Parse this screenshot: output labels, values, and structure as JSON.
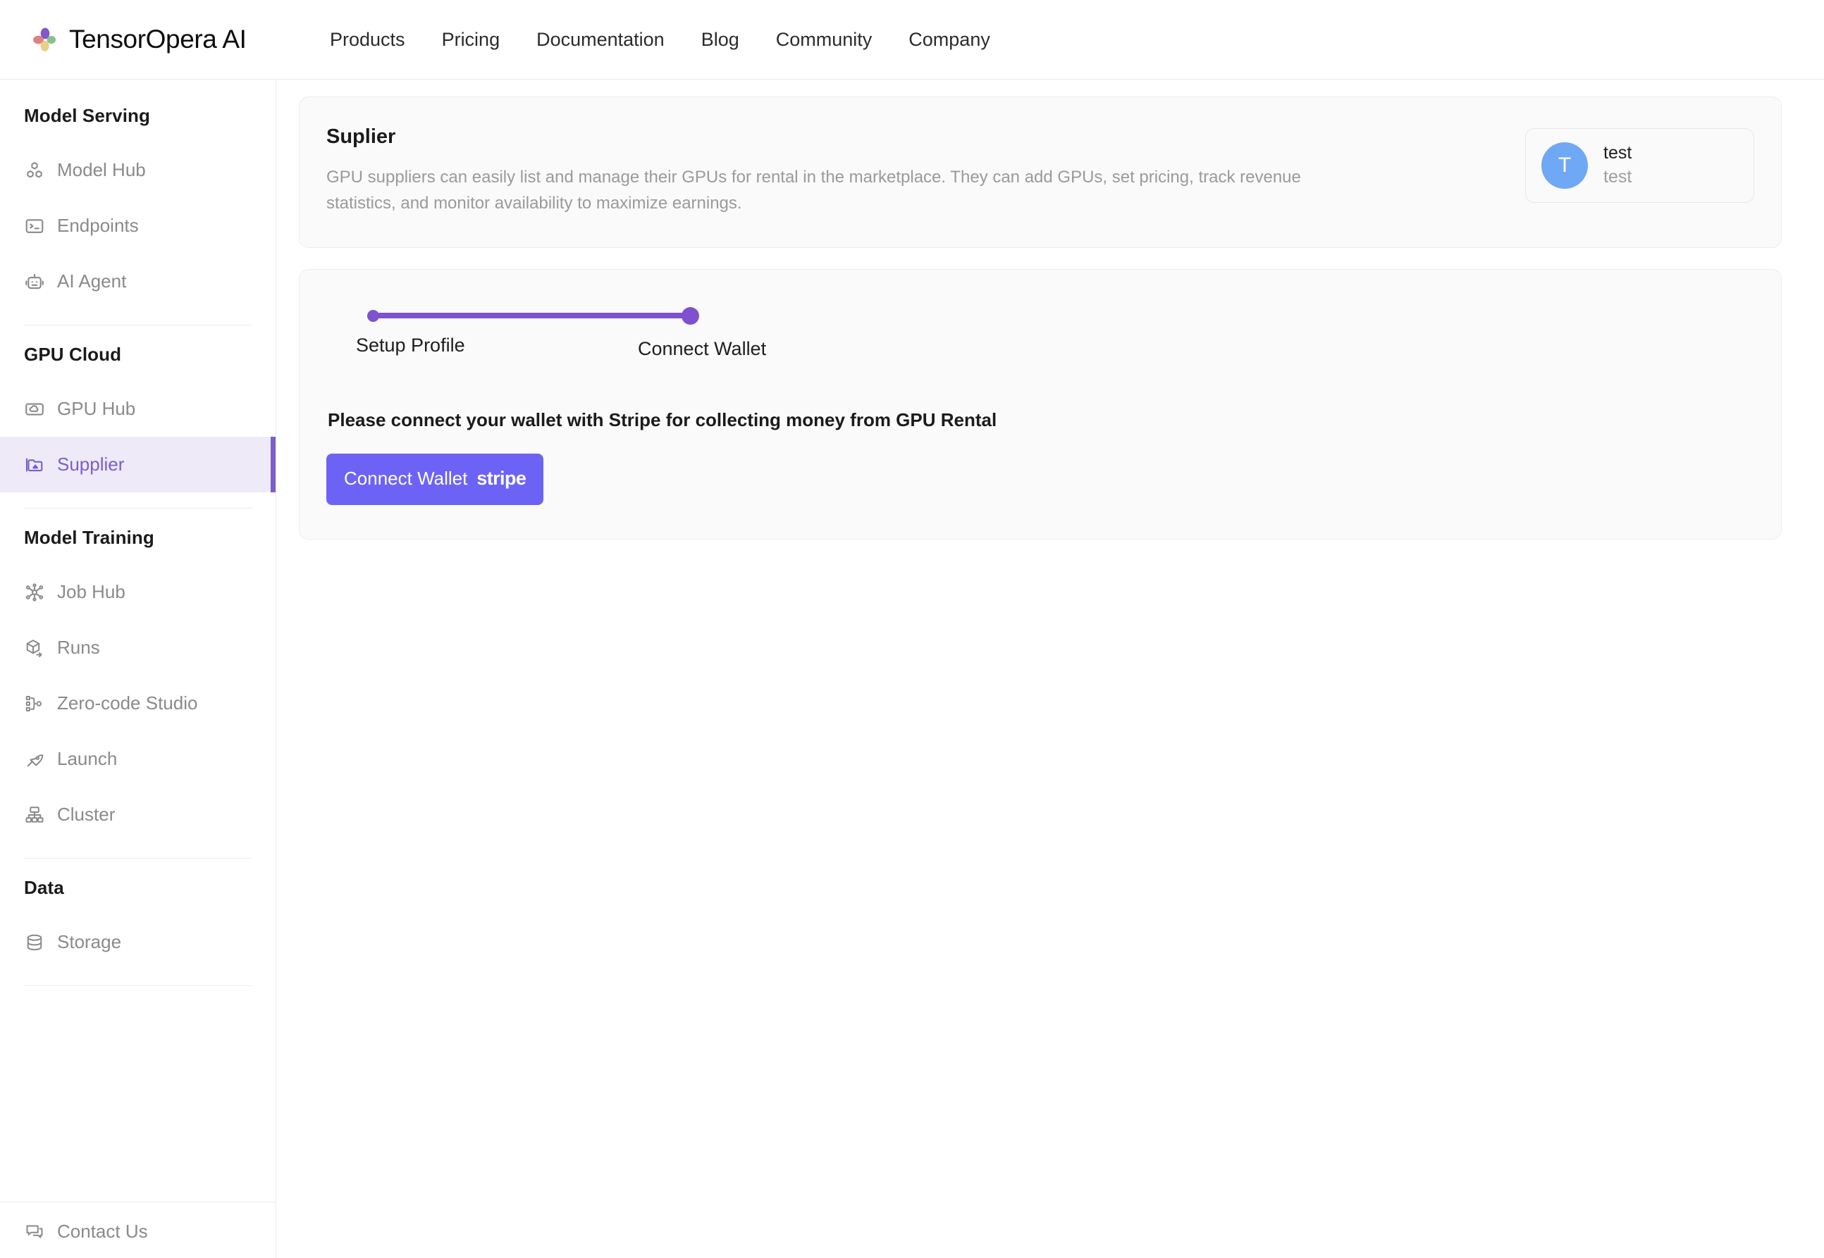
{
  "brand": {
    "name": "TensorOpera AI",
    "logo_icon": "four-petal-flower-logo",
    "colors": {
      "petal_top": "#8257c8",
      "petal_left": "#e08080",
      "petal_right": "#86c38a",
      "petal_bottom": "#e8ce86"
    }
  },
  "topnav": {
    "items": [
      {
        "label": "Products"
      },
      {
        "label": "Pricing"
      },
      {
        "label": "Documentation"
      },
      {
        "label": "Blog"
      },
      {
        "label": "Community"
      },
      {
        "label": "Company"
      }
    ]
  },
  "sidebar": {
    "groups": [
      {
        "title": "Model Serving",
        "items": [
          {
            "label": "Model Hub",
            "icon": "boxes-icon",
            "active": false
          },
          {
            "label": "Endpoints",
            "icon": "terminal-icon",
            "active": false
          },
          {
            "label": "AI Agent",
            "icon": "robot-icon",
            "active": false
          }
        ]
      },
      {
        "title": "GPU Cloud",
        "items": [
          {
            "label": "GPU Hub",
            "icon": "cloud-card-icon",
            "active": false
          },
          {
            "label": "Supplier",
            "icon": "folder-copy-icon",
            "active": true
          }
        ]
      },
      {
        "title": "Model Training",
        "items": [
          {
            "label": "Job Hub",
            "icon": "network-nodes-icon",
            "active": false
          },
          {
            "label": "Runs",
            "icon": "cube-arrow-icon",
            "active": false
          },
          {
            "label": "Zero-code Studio",
            "icon": "flow-branch-icon",
            "active": false
          },
          {
            "label": "Launch",
            "icon": "rocket-icon",
            "active": false
          },
          {
            "label": "Cluster",
            "icon": "cluster-hierarchy-icon",
            "active": false
          }
        ]
      },
      {
        "title": "Data",
        "items": [
          {
            "label": "Storage",
            "icon": "database-icon",
            "active": false
          }
        ]
      }
    ],
    "footer": {
      "label": "Contact Us",
      "icon": "chat-bubble-icon"
    },
    "active_accent": "#7b5ec9",
    "active_bg": "#eeeaf8"
  },
  "page": {
    "title": "Suplier",
    "description": "GPU suppliers can easily list and manage their GPUs for rental in the marketplace. They can add GPUs, set pricing, track revenue statistics, and monitor availability to maximize earnings.",
    "user": {
      "avatar_initial": "T",
      "avatar_color": "#6fa8f5",
      "name": "test",
      "subtitle": "test"
    },
    "stepper": {
      "accent": "#7e51cf",
      "steps": [
        {
          "label": "Setup Profile",
          "state": "done"
        },
        {
          "label": "Connect Wallet",
          "state": "current"
        }
      ]
    },
    "prompt": "Please connect your wallet with Stripe for collecting money from GPU Rental",
    "connect_button": {
      "label": "Connect Wallet",
      "brand": "stripe",
      "color": "#6c63f6"
    }
  }
}
